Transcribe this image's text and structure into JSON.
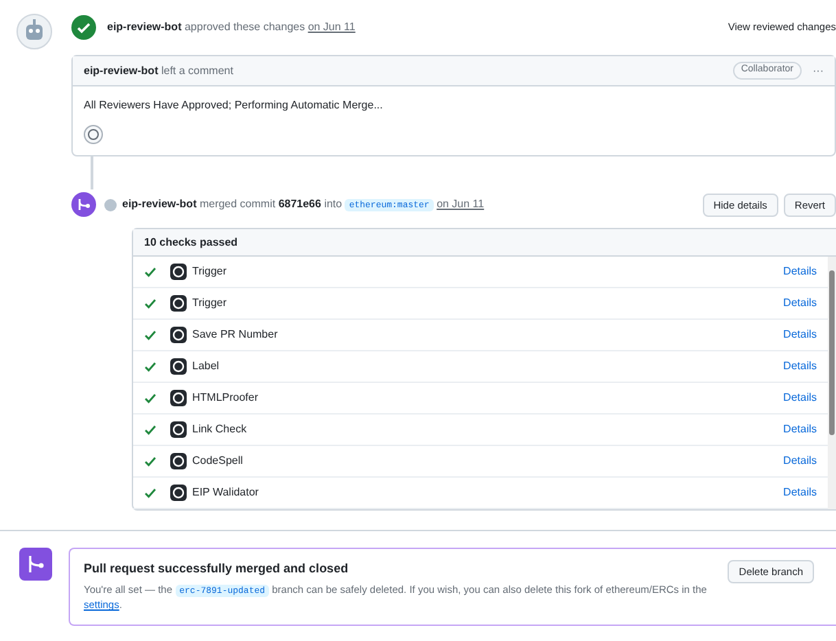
{
  "review": {
    "author": "eip-review-bot",
    "action": "approved these changes",
    "date": "on Jun 11",
    "view_link": "View reviewed changes"
  },
  "comment": {
    "author": "eip-review-bot",
    "action": "left a comment",
    "badge": "Collaborator",
    "menu": "···",
    "body": "All Reviewers Have Approved; Performing Automatic Merge..."
  },
  "merge_event": {
    "author": "eip-review-bot",
    "action": "merged commit",
    "commit": "6871e66",
    "into": "into",
    "branch": "ethereum:master",
    "date": "on Jun 11",
    "buttons": [
      "Hide details",
      "Revert"
    ]
  },
  "checks": {
    "title": "10 checks passed",
    "items": [
      {
        "name": "Trigger",
        "link": "Details"
      },
      {
        "name": "Trigger",
        "link": "Details"
      },
      {
        "name": "Save PR Number",
        "link": "Details"
      },
      {
        "name": "Label",
        "link": "Details"
      },
      {
        "name": "HTMLProofer",
        "link": "Details"
      },
      {
        "name": "Link Check",
        "link": "Details"
      },
      {
        "name": "CodeSpell",
        "link": "Details"
      },
      {
        "name": "EIP Walidator",
        "link": "Details"
      }
    ]
  },
  "merged_banner": {
    "title": "Pull request successfully merged and closed",
    "text_before": "You're all set — the",
    "branch": "erc-7891-updated",
    "text_middle": "branch can be safely deleted. If you wish, you can also delete this fork of ethereum/ERCs in the",
    "link": "settings",
    "text_after": ".",
    "button": "Delete branch"
  }
}
